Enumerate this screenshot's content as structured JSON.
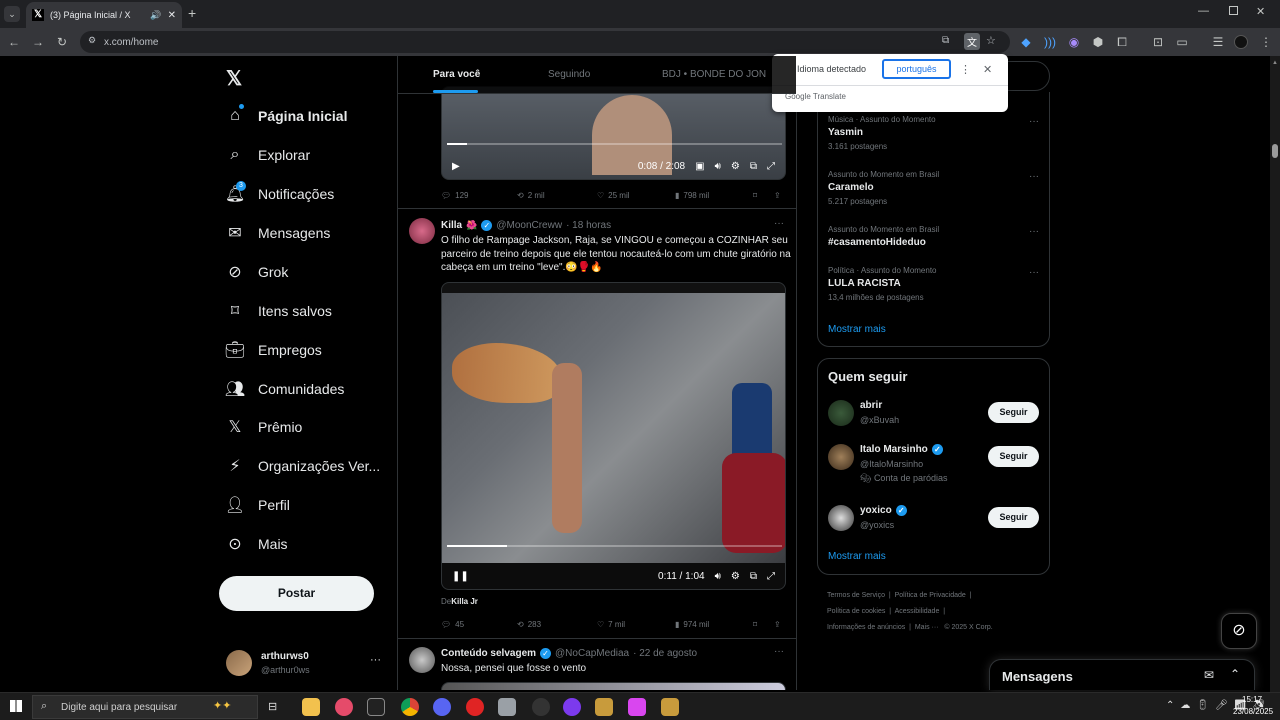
{
  "browser": {
    "tab_title": "(3) Página Inicial / X",
    "url": "x.com/home"
  },
  "translate_popup": {
    "detected_label": "Idioma detectado",
    "language_button": "português",
    "brand": "Google",
    "brand_suffix": "Translate"
  },
  "nav": {
    "items": [
      {
        "label": "Página Inicial",
        "icon": "home-icon"
      },
      {
        "label": "Explorar",
        "icon": "search-icon"
      },
      {
        "label": "Notificações",
        "icon": "bell-icon",
        "badge": "3"
      },
      {
        "label": "Mensagens",
        "icon": "mail-icon"
      },
      {
        "label": "Grok",
        "icon": "grok-icon"
      },
      {
        "label": "Itens salvos",
        "icon": "bookmark-icon"
      },
      {
        "label": "Empregos",
        "icon": "briefcase-icon"
      },
      {
        "label": "Comunidades",
        "icon": "people-icon"
      },
      {
        "label": "Prêmio",
        "icon": "x-icon"
      },
      {
        "label": "Organizações Ver...",
        "icon": "lightning-icon"
      },
      {
        "label": "Perfil",
        "icon": "person-icon"
      },
      {
        "label": "Mais",
        "icon": "more-circle-icon"
      }
    ],
    "post_button": "Postar",
    "account": {
      "name": "arthurws0",
      "handle": "@arthur0ws"
    }
  },
  "feed": {
    "tabs": [
      "Para você",
      "Seguindo",
      "BDJ • BONDE DO JON"
    ],
    "tweet1": {
      "video_time": "0:08 / 2:08",
      "replies": "129",
      "reposts": "2 mil",
      "likes": "25 mil",
      "views": "798 mil"
    },
    "tweet2": {
      "name": "Killa",
      "handle": "@MoonCreww",
      "time": "· 18 horas",
      "text": "O filho de Rampage Jackson, Raja, se VINGOU e começou a COZINHAR seu parceiro de treino depois que ele tentou nocauteá-lo com um chute giratório na cabeça em um treino \"leve\".😳🥊🔥",
      "video_time": "0:11 / 1:04",
      "source_prefix": "De",
      "source_name": "Killa Jr",
      "replies": "45",
      "reposts": "283",
      "likes": "7 mil",
      "views": "974 mil"
    },
    "tweet3": {
      "name": "Conteúdo selvagem",
      "handle": "@NoCapMediaa",
      "time": "· 22 de agosto",
      "text": "Nossa, pensei que fosse o vento"
    }
  },
  "trends": {
    "items": [
      {
        "category": "Música · Assunto do Momento",
        "title": "Yasmin",
        "count": "3.161 postagens"
      },
      {
        "category": "Assunto do Momento em Brasil",
        "title": "Caramelo",
        "count": "5.217 postagens"
      },
      {
        "category": "Assunto do Momento em Brasil",
        "title": "#casamentoHideduo",
        "count": ""
      },
      {
        "category": "Política · Assunto do Momento",
        "title": "LULA RACISTA",
        "count": "13,4 milhões de postagens"
      }
    ],
    "show_more": "Mostrar mais"
  },
  "who_to_follow": {
    "title": "Quem seguir",
    "items": [
      {
        "name": "abrir",
        "handle": "@xBuvah",
        "verified": false,
        "note": ""
      },
      {
        "name": "Italo Marsinho",
        "handle": "@ItaloMarsinho",
        "verified": true,
        "note": "Conta de paródias"
      },
      {
        "name": "yoxico",
        "handle": "@yoxics",
        "verified": true,
        "note": ""
      }
    ],
    "follow_label": "Seguir",
    "show_more": "Mostrar mais"
  },
  "footer": {
    "links": [
      "Termos de Serviço",
      "Política de Privacidade",
      "Política de cookies",
      "Acessibilidade",
      "Informações de anúncios",
      "Mais ···"
    ],
    "copyright": "© 2025 X Corp."
  },
  "messages_dock": {
    "title": "Mensagens"
  },
  "taskbar": {
    "search_placeholder": "Digite aqui para pesquisar",
    "time": "15:17",
    "date": "23/08/2025"
  },
  "colors": {
    "accent": "#1d9bf0",
    "bg": "#000000",
    "border": "#2f3336",
    "muted": "#71767b"
  }
}
